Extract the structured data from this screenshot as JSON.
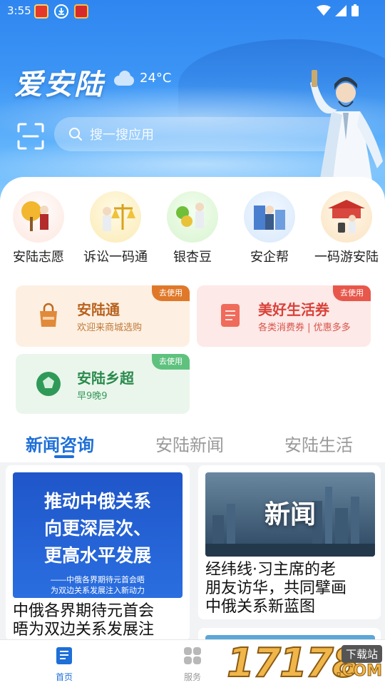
{
  "status_bar": {
    "time": "3:55"
  },
  "header": {
    "brand": "爱安陆",
    "temperature": "24°C",
    "search_placeholder": "搜一搜应用"
  },
  "apps": [
    {
      "label": "安陆志愿"
    },
    {
      "label": "诉讼一码通"
    },
    {
      "label": "银杏豆"
    },
    {
      "label": "安企帮"
    },
    {
      "label": "一码游安陆"
    }
  ],
  "cards": [
    {
      "title": "安陆通",
      "subtitle": "欢迎来商城选购",
      "tag": "去使用"
    },
    {
      "title": "美好生活券",
      "subtitle": "各类消费券 | 优惠多多",
      "tag": "去使用"
    },
    {
      "title": "安陆乡超",
      "subtitle": "早9晚9",
      "tag": "去使用"
    }
  ],
  "tabs": [
    {
      "label": "新闻咨询",
      "active": true
    },
    {
      "label": "安陆新闻",
      "active": false
    },
    {
      "label": "安陆生活",
      "active": false
    }
  ],
  "news": [
    {
      "image_lines": [
        "推动中俄关系",
        "向更深层次、",
        "更高水平发展"
      ],
      "image_caption": [
        "——中俄各界期待元首会晤",
        "为双边关系发展注入新动力"
      ],
      "title_lines": [
        "中俄各界期待元首会",
        "晤为双边关系发展注"
      ]
    },
    {
      "image_text": "新闻",
      "title_lines": [
        "经纬线·习主席的老",
        "朋友访华，共同擘画",
        "中俄关系新蓝图"
      ]
    }
  ],
  "bottom_nav": [
    {
      "label": "首页",
      "active": true
    },
    {
      "label": "服务",
      "active": false
    }
  ],
  "watermark": {
    "number": "17178",
    "tag": "下载站",
    "suffix": ".COM"
  },
  "colors": {
    "primary": "#1e6fd8",
    "orange": "#e0782a",
    "red": "#e8574b",
    "green": "#3aa860"
  }
}
